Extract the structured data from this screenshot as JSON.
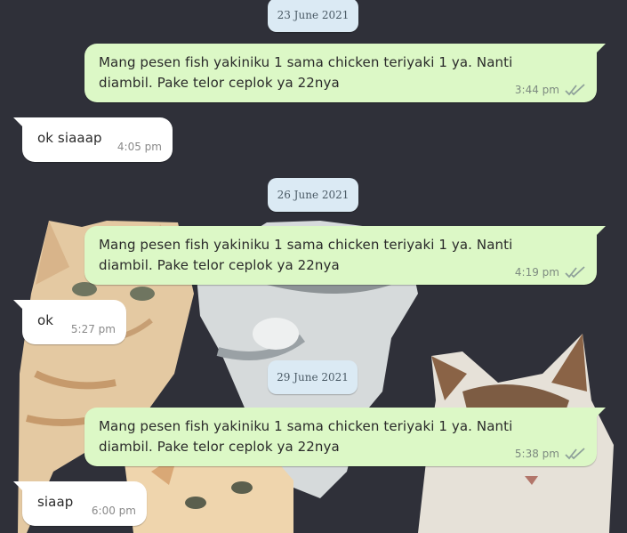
{
  "dates": [
    "23 June 2021",
    "26 June 2021",
    "29 June 2021"
  ],
  "messages": [
    {
      "dir": "out",
      "text": "Mang pesen fish yakiniku 1 sama chicken teriyaki 1 ya. Nanti diambil. Pake telor ceplok ya 22nya",
      "time": "3:44 pm",
      "status": "read-double-check-icon"
    },
    {
      "dir": "in",
      "text": "ok siaaap",
      "time": "4:05 pm"
    },
    {
      "dir": "out",
      "text": "Mang pesen fish yakiniku 1 sama chicken teriyaki 1 ya. Nanti diambil. Pake telor ceplok ya 22nya",
      "time": "4:19 pm",
      "status": "read-double-check-icon"
    },
    {
      "dir": "in",
      "text": "ok",
      "time": "5:27 pm"
    },
    {
      "dir": "out",
      "text": "Mang pesen fish yakiniku 1 sama chicken teriyaki 1 ya. Nanti diambil. Pake telor ceplok ya 22nya",
      "time": "5:38 pm",
      "status": "read-double-check-icon"
    },
    {
      "dir": "in",
      "text": "siaap",
      "time": "6:00 pm"
    }
  ],
  "colors": {
    "background": "#2f3039",
    "outgoing_bubble": "#dcf8c6",
    "incoming_bubble": "#ffffff",
    "date_chip": "#dbeaf4"
  }
}
